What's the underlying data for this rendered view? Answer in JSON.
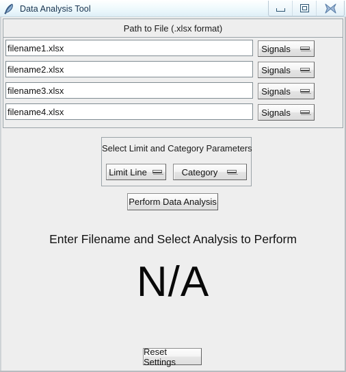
{
  "window": {
    "title": "Data Analysis Tool",
    "icon": "java-feather-icon",
    "controls": {
      "minimize": "minimize-icon",
      "restore": "restore-icon",
      "close": "close-icon",
      "close_glyph": "✖"
    }
  },
  "path_panel": {
    "header": "Path to File (.xlsx format)",
    "rows": [
      {
        "value": "filename1.xlsx",
        "placeholder": "",
        "button": "Signals"
      },
      {
        "value": "filename2.xlsx",
        "placeholder": "",
        "button": "Signals"
      },
      {
        "value": "filename3.xlsx",
        "placeholder": "",
        "button": "Signals"
      },
      {
        "value": "filename4.xlsx",
        "placeholder": "",
        "button": "Signals"
      }
    ]
  },
  "params_panel": {
    "title": "Select Limit and Category Parameters",
    "limit_line": "Limit Line",
    "category": "Category"
  },
  "actions": {
    "perform": "Perform Data Analysis",
    "reset": "Reset Settings"
  },
  "status": {
    "message": "Enter Filename and Select Analysis to Perform",
    "result": "N/A"
  },
  "colors": {
    "window_bg": "#eeeeee",
    "panel_border": "#9aa3a8",
    "titlebar_top": "#ffffff",
    "titlebar_bottom": "#ddeef6",
    "text": "#111111",
    "title_text": "#14304c",
    "input_bg": "#ffffff"
  }
}
